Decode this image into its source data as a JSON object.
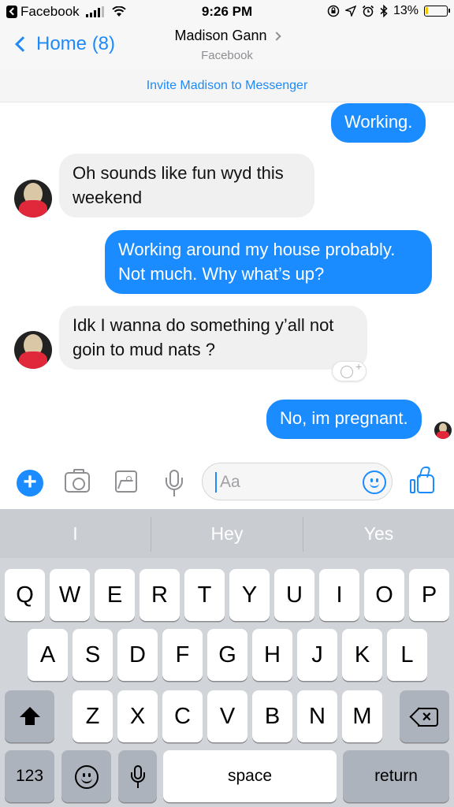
{
  "status_bar": {
    "back_app": "Facebook",
    "time": "9:26 PM",
    "battery": "13%",
    "battery_level": 0.13,
    "battery_color": "#f4c600"
  },
  "nav": {
    "back_label": "Home (8)",
    "contact_name": "Madison Gann",
    "contact_subtitle": "Facebook"
  },
  "invite_banner": "Invite Madison to Messenger",
  "messages": [
    {
      "direction": "outgoing",
      "text": "Working."
    },
    {
      "direction": "incoming",
      "line1": "Oh sounds like fun wyd this",
      "line2": "weekend"
    },
    {
      "direction": "outgoing",
      "line1": "Working around my house probably.",
      "line2": "Not much. Why what’s up?"
    },
    {
      "direction": "incoming",
      "line1": "Idk I wanna do something y’all not",
      "line2": "goin to mud nats ?"
    },
    {
      "direction": "outgoing",
      "text": "No, im pregnant."
    }
  ],
  "composer": {
    "placeholder": "Aa",
    "accent_color": "#1a8cff"
  },
  "keyboard": {
    "suggestions": [
      "I",
      "Hey",
      "Yes"
    ],
    "row1": [
      "Q",
      "W",
      "E",
      "R",
      "T",
      "Y",
      "U",
      "I",
      "O",
      "P"
    ],
    "row2": [
      "A",
      "S",
      "D",
      "F",
      "G",
      "H",
      "J",
      "K",
      "L"
    ],
    "row3": [
      "Z",
      "X",
      "C",
      "V",
      "B",
      "N",
      "M"
    ],
    "numbers_key": "123",
    "space_key": "space",
    "return_key": "return"
  },
  "icons": {
    "status_back": "back-to-app-icon",
    "signal": "cellular-signal-icon",
    "wifi": "wifi-icon",
    "status_right": [
      "lock-rotation-icon",
      "location-arrow-icon",
      "alarm-icon",
      "bluetooth-icon"
    ],
    "composer": [
      "plus-icon",
      "camera-icon",
      "image-icon",
      "microphone-icon",
      "emoji-icon",
      "thumbs-up-icon"
    ],
    "reaction": "add-reaction-icon"
  }
}
